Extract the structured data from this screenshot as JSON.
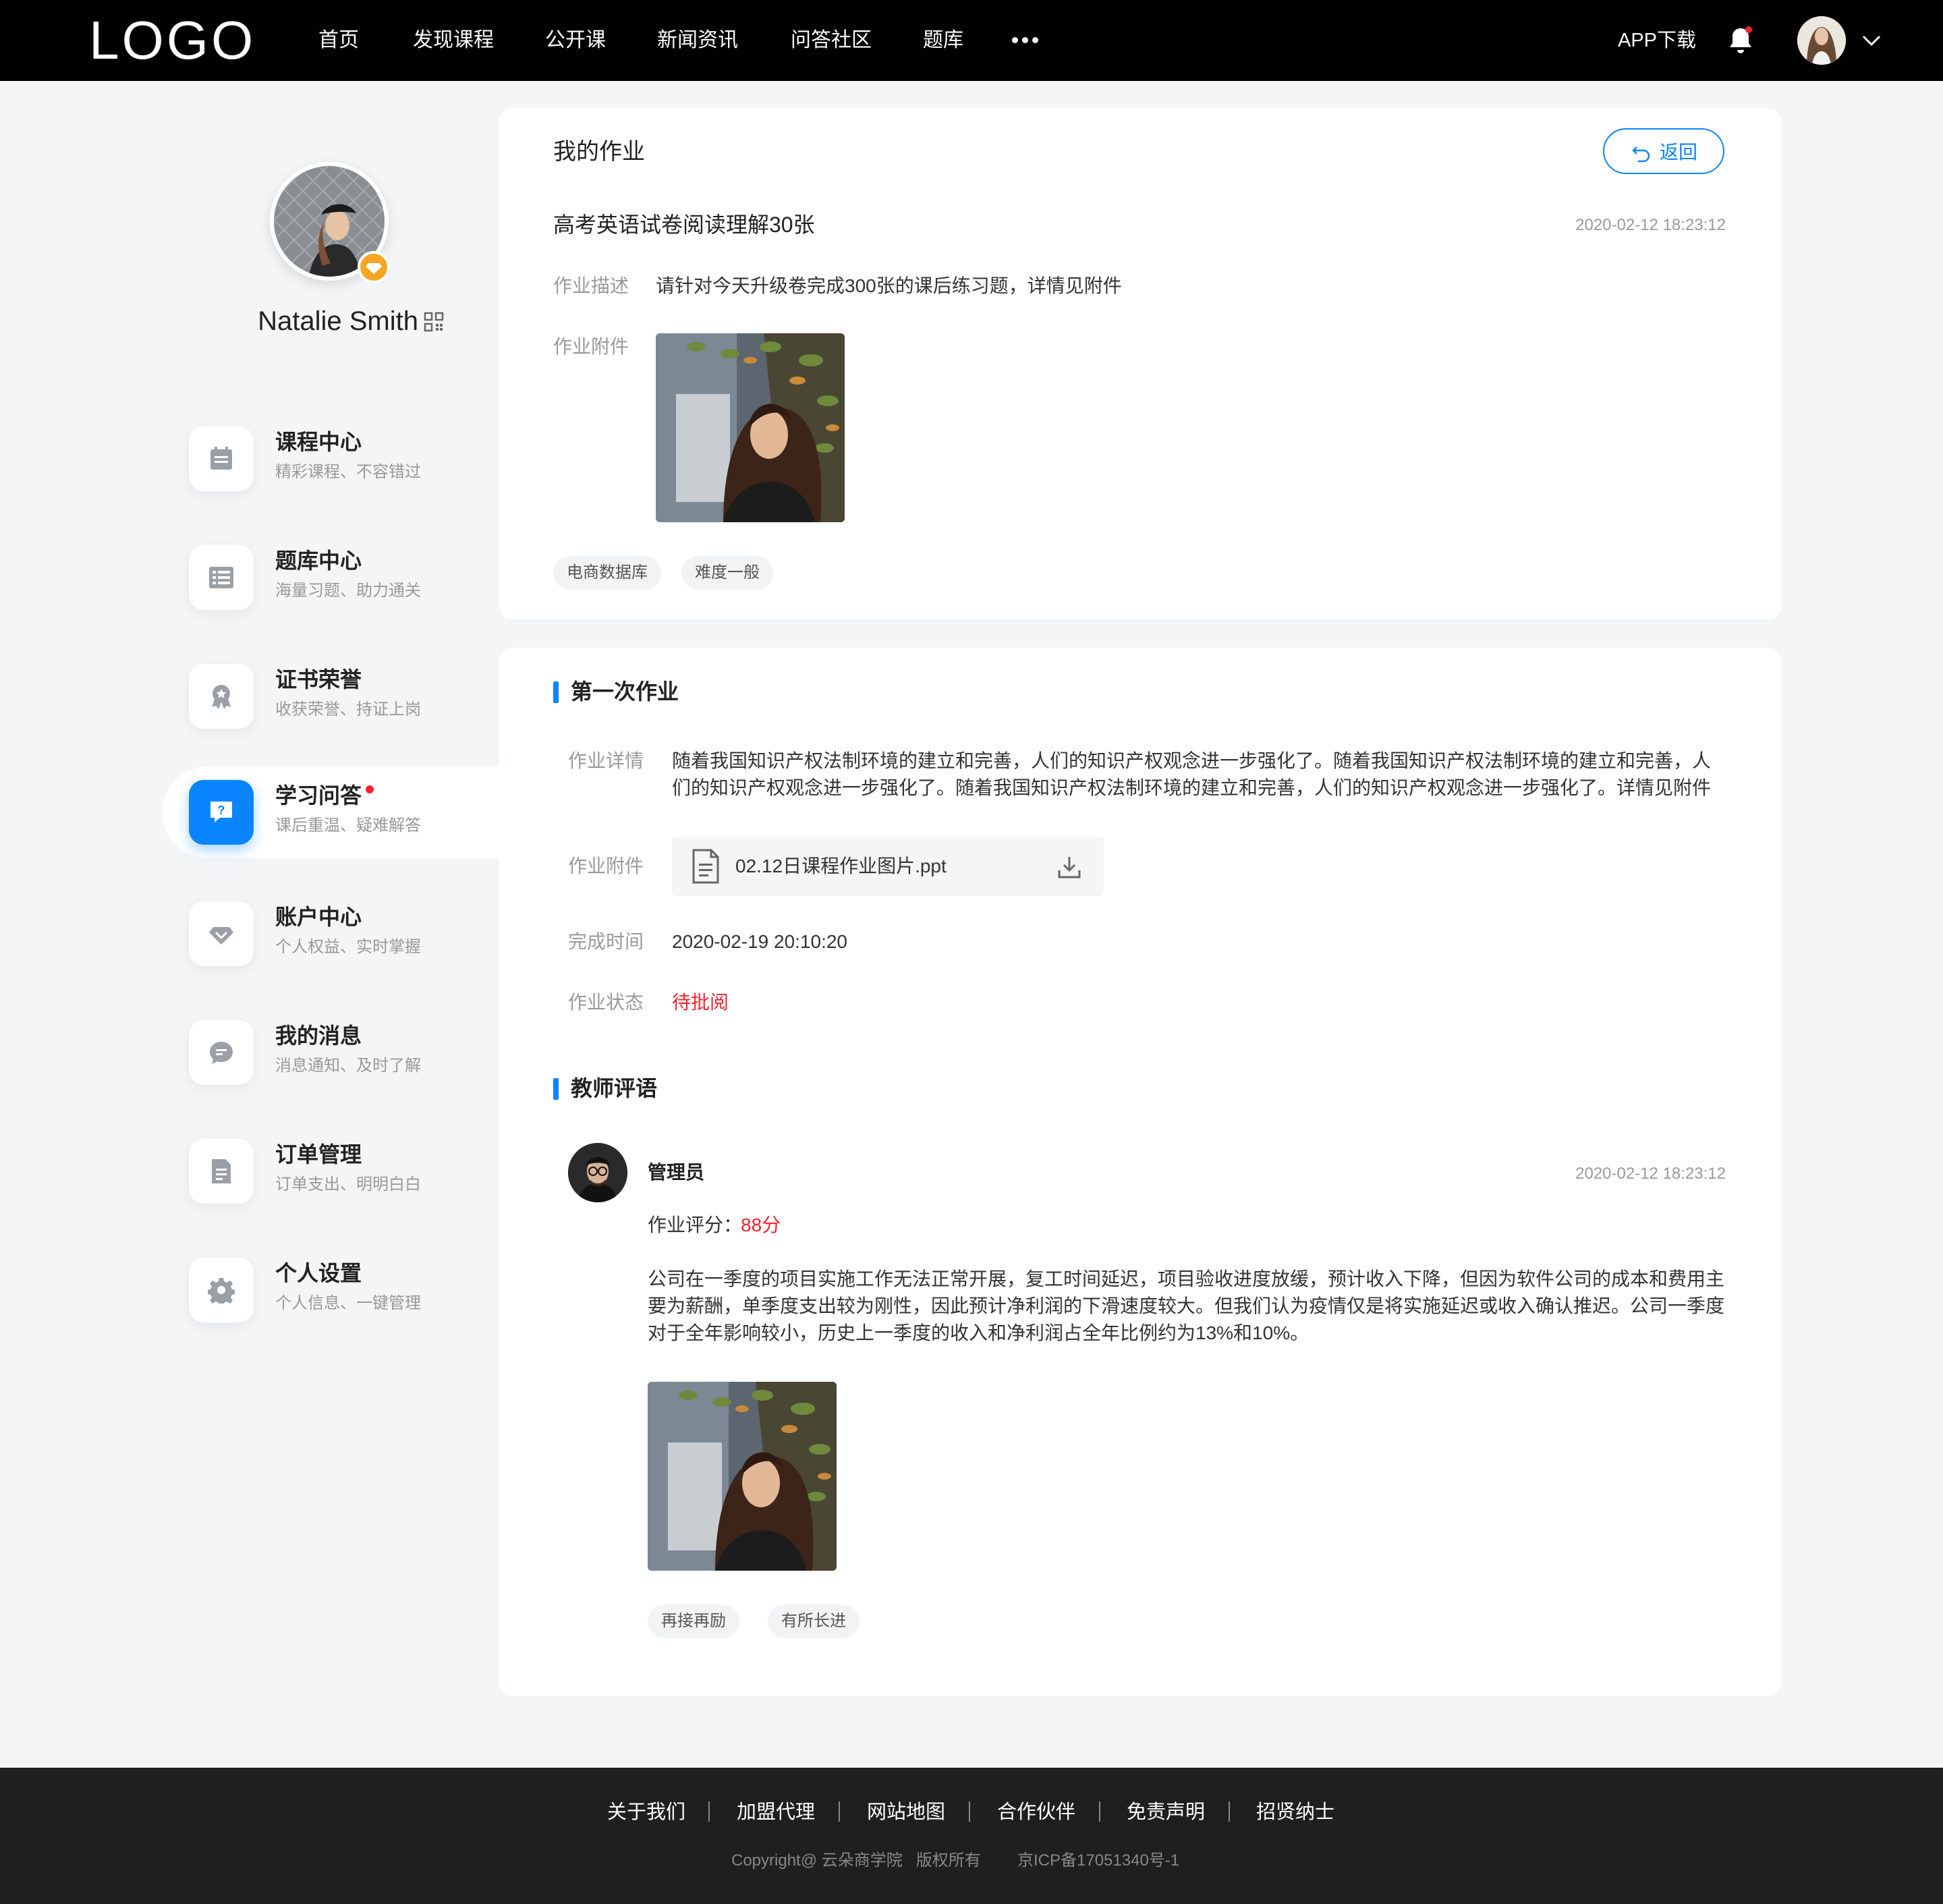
{
  "header": {
    "logo": "LOGO",
    "nav": [
      "首页",
      "发现课程",
      "公开课",
      "新闻资讯",
      "问答社区",
      "题库"
    ],
    "app_download": "APP下载"
  },
  "profile": {
    "name": "Natalie Smith"
  },
  "sidebar": {
    "items": [
      {
        "title": "课程中心",
        "subtitle": "精彩课程、不容错过",
        "icon": "calendar-icon"
      },
      {
        "title": "题库中心",
        "subtitle": "海量习题、助力通关",
        "icon": "question-bank-icon"
      },
      {
        "title": "证书荣誉",
        "subtitle": "收获荣誉、持证上岗",
        "icon": "award-icon"
      },
      {
        "title": "学习问答",
        "subtitle": "课后重温、疑难解答",
        "icon": "qa-icon",
        "active": true
      },
      {
        "title": "账户中心",
        "subtitle": "个人权益、实时掌握",
        "icon": "diamond-icon"
      },
      {
        "title": "我的消息",
        "subtitle": "消息通知、及时了解",
        "icon": "message-icon"
      },
      {
        "title": "订单管理",
        "subtitle": "订单支出、明明白白",
        "icon": "document-icon"
      },
      {
        "title": "个人设置",
        "subtitle": "个人信息、一键管理",
        "icon": "gear-icon"
      }
    ]
  },
  "homework": {
    "page_title": "我的作业",
    "back_label": "返回",
    "title": "高考英语试卷阅读理解30张",
    "date": "2020-02-12 18:23:12",
    "desc_label": "作业描述",
    "desc": "请针对今天升级卷完成300张的课后练习题，详情见附件",
    "attach_label": "作业附件",
    "tags": [
      "电商数据库",
      "难度一般"
    ]
  },
  "submission": {
    "section_title": "第一次作业",
    "detail_label": "作业详情",
    "detail_line1": "随着我国知识产权法制环境的建立和完善，人们的知识产权观念进一步强化了。随着我国知识产权法制环境的建立和完善，人",
    "detail_line2": "们的知识产权观念进一步强化了。随着我国知识产权法制环境的建立和完善，人们的知识产权观念进一步强化了。详情见附件",
    "attach_label": "作业附件",
    "file_name": "02.12日课程作业图片.ppt",
    "time_label": "完成时间",
    "time": "2020-02-19 20:10:20",
    "status_label": "作业状态",
    "status": "待批阅",
    "status_color": "#f5222d"
  },
  "review": {
    "section_title": "教师评语",
    "teacher": "管理员",
    "date": "2020-02-12 18:23:12",
    "score_label": "作业评分：",
    "score": "88分",
    "comment_line1": "公司在一季度的项目实施工作无法正常开展，复工时间延迟，项目验收进度放缓，预计收入下降，但因为软件公司的成本和费用主",
    "comment_line2": "要为薪酬，单季度支出较为刚性，因此预计净利润的下滑速度较大。但我们认为疫情仅是将实施延迟或收入确认推迟。公司一季度",
    "comment_line3": "对于全年影响较小，历史上一季度的收入和净利润占全年比例约为13%和10%。",
    "tags": [
      "再接再励",
      "有所长进"
    ]
  },
  "footer": {
    "links": [
      "关于我们",
      "加盟代理",
      "网站地图",
      "合作伙伴",
      "免责声明",
      "招贤纳士"
    ],
    "copyright": "Copyright@ 云朵商学院   版权所有",
    "icp": "京ICP备17051340号-1"
  },
  "colors": {
    "accent": "#0a85ff",
    "danger": "#f5222d",
    "vip": "#f6a623"
  }
}
